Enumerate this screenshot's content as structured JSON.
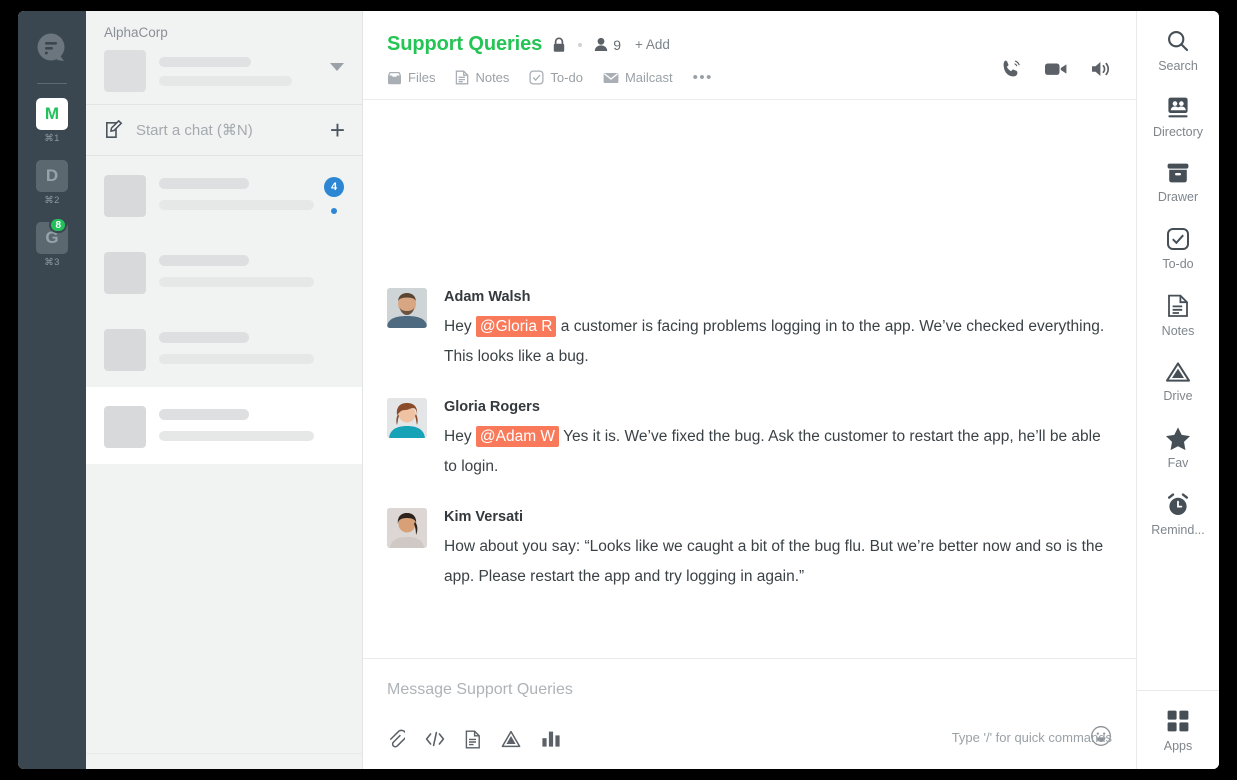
{
  "colors": {
    "rail_bg": "#3a4750",
    "accent_green": "#24c455",
    "mention_bg": "#f97a5b",
    "badge_blue": "#2d86d4",
    "badge_green": "#22c15c"
  },
  "rail": {
    "logo_icon": "cliq-bubble-logo-icon",
    "workspaces": [
      {
        "letter": "M",
        "shortcut": "⌘1",
        "active": true,
        "badge": ""
      },
      {
        "letter": "D",
        "shortcut": "⌘2",
        "active": false,
        "badge": ""
      },
      {
        "letter": "G",
        "shortcut": "⌘3",
        "active": false,
        "badge": "8"
      }
    ]
  },
  "list_panel": {
    "org_name": "AlphaCorp",
    "org_caret_icon": "chevron-down-icon",
    "start_chat_label": "Start a chat (⌘N)",
    "start_chat_icon": "compose-icon",
    "add_icon": "plus-icon",
    "chats": [
      {
        "badge": "4",
        "has_dot": true,
        "selected": false
      },
      {
        "badge": "",
        "has_dot": false,
        "selected": false
      },
      {
        "badge": "",
        "has_dot": false,
        "selected": false
      },
      {
        "badge": "",
        "has_dot": false,
        "selected": true
      }
    ]
  },
  "header": {
    "title": "Support Queries",
    "lock_icon": "lock-icon",
    "member_icon": "person-icon",
    "member_count": "9",
    "add_label": "+ Add",
    "tabs": [
      {
        "label": "Files",
        "icon": "files-icon"
      },
      {
        "label": "Notes",
        "icon": "notes-icon"
      },
      {
        "label": "To-do",
        "icon": "checkbox-icon"
      },
      {
        "label": "Mailcast",
        "icon": "mail-icon"
      }
    ],
    "more_label": "•••",
    "actions": [
      {
        "name": "audio-call-icon"
      },
      {
        "name": "video-call-icon"
      },
      {
        "name": "speaker-icon"
      }
    ]
  },
  "messages": [
    {
      "author": "Adam Walsh",
      "avatar": "adam-walsh-avatar",
      "pre": "Hey ",
      "mention": "@Gloria R",
      "post": " a customer is facing problems logging in to the app. We’ve checked everything. This looks like a bug."
    },
    {
      "author": "Gloria Rogers",
      "avatar": "gloria-rogers-avatar",
      "pre": "Hey ",
      "mention": "@Adam W",
      "post": " Yes it is. We’ve fixed the bug. Ask the customer to restart the app, he’ll be able to login."
    },
    {
      "author": "Kim Versati",
      "avatar": "kim-versati-avatar",
      "pre": "How about you say: “Looks like we caught a bit of the bug flu. But we’re better now and so is the app. Please restart the app and try logging in again.”",
      "mention": "",
      "post": ""
    }
  ],
  "composer": {
    "placeholder": "Message Support Queries",
    "hint": "Type '/' for quick commands",
    "emoji_icon": "smiley-icon",
    "tools": [
      {
        "name": "attach-icon"
      },
      {
        "name": "code-icon"
      },
      {
        "name": "document-icon"
      },
      {
        "name": "drive-icon"
      },
      {
        "name": "poll-icon"
      }
    ]
  },
  "right_rail": {
    "items": [
      {
        "label": "Search",
        "icon": "search-icon"
      },
      {
        "label": "Directory",
        "icon": "directory-icon"
      },
      {
        "label": "Drawer",
        "icon": "drawer-icon"
      },
      {
        "label": "To-do",
        "icon": "checkbox-icon"
      },
      {
        "label": "Notes",
        "icon": "notes-icon"
      },
      {
        "label": "Drive",
        "icon": "drive-icon"
      },
      {
        "label": "Fav",
        "icon": "star-icon"
      },
      {
        "label": "Remind...",
        "icon": "alarm-clock-icon"
      }
    ],
    "footer": {
      "label": "Apps",
      "icon": "apps-grid-icon"
    }
  }
}
